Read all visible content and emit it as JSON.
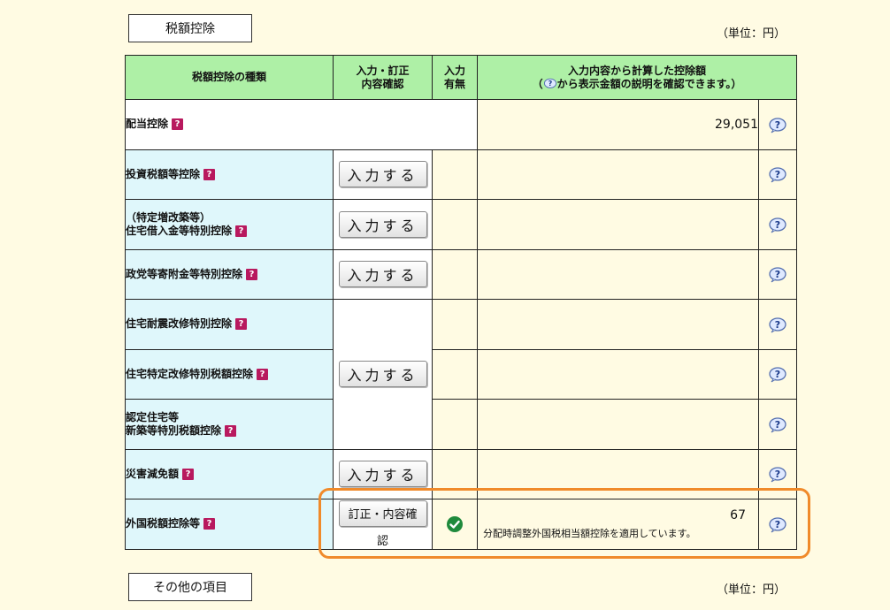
{
  "section_title": "税額控除",
  "unit_label": "（単位：円）",
  "table": {
    "header": {
      "col_type": "税額控除の種類",
      "col_input_line1": "入力・訂正",
      "col_input_line2": "内容確認",
      "col_flag_line1": "入力",
      "col_flag_line2": "有無",
      "col_amount_line1": "入力内容から計算した控除額",
      "col_amount_line2_pre": "（",
      "col_amount_line2_post": "から表示金額の説明を確認できます。）"
    },
    "rows": [
      {
        "label1": "配当控除",
        "label2": "",
        "amount": "29,051"
      },
      {
        "label1": "投資税額等控除",
        "label2": "",
        "button": "入力する"
      },
      {
        "label1": "（特定増改築等）",
        "label2": "住宅借入金等特別控除",
        "button": "入力する"
      },
      {
        "label1": "政党等寄附金等特別控除",
        "label2": "",
        "button": "入力する"
      },
      {
        "label1": "住宅耐震改修特別控除",
        "label2": ""
      },
      {
        "label1": "住宅特定改修特別税額控除",
        "label2": "",
        "button": "入力する"
      },
      {
        "label1": "認定住宅等",
        "label2": "新築等特別税額控除"
      },
      {
        "label1": "災害減免額",
        "label2": "",
        "button": "入力する"
      },
      {
        "label1": "外国税額控除等",
        "label2": "",
        "button": "訂正・内容確認",
        "amount": "67",
        "note": "分配時調整外国税相当額控除を適用しています。"
      }
    ]
  },
  "help_glyph": "?",
  "next_section_title": "その他の項目",
  "next_unit_label": "（単位：円）",
  "colors": {
    "header_bg": "#aef0a6",
    "label_bg": "#dff7fb",
    "page_bg": "#fffbe3",
    "highlight": "#f08a2a"
  },
  "icons": {
    "help": "question-balloon-icon",
    "check": "check-circle-icon",
    "qmark": "help-square-icon"
  }
}
